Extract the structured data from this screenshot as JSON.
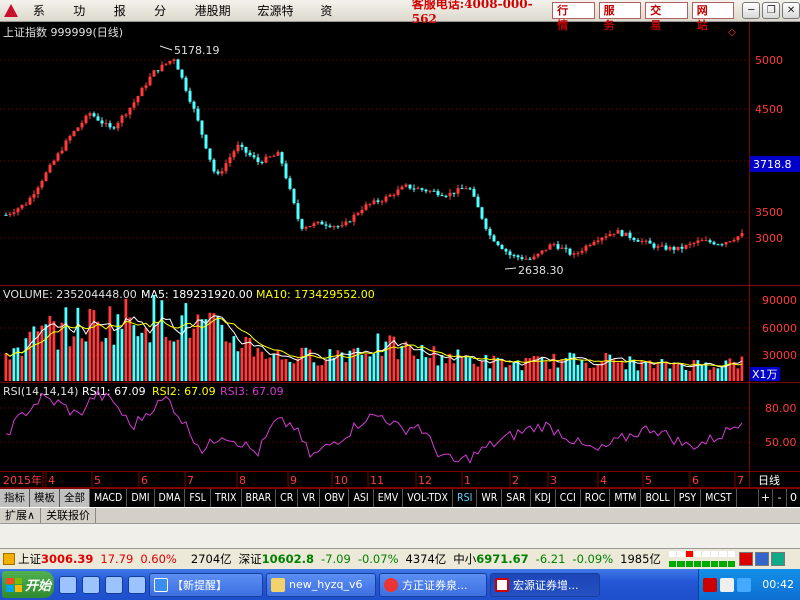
{
  "menubar": {
    "items": [
      "系统",
      "功能",
      "报价",
      "分析",
      "港股期货",
      "宏源特色",
      "资讯"
    ],
    "hotline": "客服电话:4008-000-562",
    "buttons": [
      "行 情",
      "服 务",
      "交 易",
      "网 站"
    ]
  },
  "main_panel": {
    "title": "上证指数 999999(日线)",
    "price_axis_ticks": [
      "5000",
      "4500",
      "4000",
      "3500",
      "3000"
    ],
    "current_price_tag": "3718.8",
    "high_label": "5178.19",
    "low_label": "2638.30"
  },
  "volume_panel": {
    "label": "VOLUME: 235204448.00",
    "ma5": "MA5: 189231920.00",
    "ma10": "MA10: 173429552.00",
    "axis_ticks": [
      "90000",
      "60000",
      "30000"
    ],
    "unit": "X1万"
  },
  "rsi_panel": {
    "label": "RSI(14,14,14)",
    "rsi1": "RSI1: 67.09",
    "rsi2": "RSI2: 67.09",
    "rsi3": "RSI3: 67.09",
    "axis_ticks": [
      "80.00",
      "50.00"
    ]
  },
  "time_axis": {
    "labels": [
      "2015年",
      "4",
      "5",
      "6",
      "7",
      "8",
      "9",
      "10",
      "11",
      "12",
      "1",
      "2",
      "3",
      "4",
      "5",
      "6",
      "7"
    ],
    "period": "日线"
  },
  "tabs": [
    "指标",
    "模板",
    "全部",
    "MACD",
    "DMI",
    "DMA",
    "FSL",
    "TRIX",
    "BRAR",
    "CR",
    "VR",
    "OBV",
    "ASI",
    "EMV",
    "VOL-TDX",
    "RSI",
    "WR",
    "SAR",
    "KDJ",
    "CCI",
    "ROC",
    "MTM",
    "BOLL",
    "PSY",
    "MCST"
  ],
  "tab_controls": [
    "+",
    "-",
    "0"
  ],
  "info_tabs": [
    "扩展∧",
    "关联报价"
  ],
  "statusbar": {
    "sh_name": "上证",
    "sh_value": "3006.39",
    "sh_change": "17.79",
    "sh_pct": "0.60%",
    "sh_amount": "2704亿",
    "sz_name": "深证",
    "sz_value": "10602.8",
    "sz_change": "-7.09",
    "sz_pct": "-0.07%",
    "sz_amount": "4374亿",
    "sm_name": "中小",
    "sm_value": "6971.67",
    "sm_change": "-6.21",
    "sm_pct": "-0.09%",
    "sm_amount": "1985亿"
  },
  "taskbar": {
    "start_label": "开始",
    "tasks": [
      "【新提醒】",
      "new_hyzq_v6",
      "方正证券泉...",
      "宏源证券增..."
    ],
    "clock": "00:42"
  },
  "colors": {
    "up": "#ff3c3c",
    "down": "#54ffff",
    "rsi": "#d23cd2",
    "ma5": "#ffffff",
    "ma10": "#ffff00",
    "grid": "#800000"
  },
  "chart_data": [
    {
      "type": "candlestick",
      "title": "上证指数 999999(日线)",
      "x_labels": [
        "2015年",
        "4",
        "5",
        "6",
        "7",
        "8",
        "9",
        "10",
        "11",
        "12",
        "1",
        "2",
        "3",
        "4",
        "5",
        "6",
        "7"
      ],
      "y_ticks": [
        3000,
        3500,
        4000,
        4500,
        5000
      ],
      "ylim": [
        2450,
        5300
      ],
      "annotations": [
        {
          "label": "5178.19",
          "value": 5178.19
        },
        {
          "label": "2638.30",
          "value": 2638.3
        },
        {
          "label": "3718.8",
          "value": 3718.8
        }
      ],
      "close_path": [
        {
          "m": "2015-03",
          "v": 3250
        },
        {
          "m": "2015-03",
          "v": 3400
        },
        {
          "m": "2015-04",
          "v": 3800
        },
        {
          "m": "2015-04",
          "v": 4200
        },
        {
          "m": "2015-05",
          "v": 4500
        },
        {
          "m": "2015-05",
          "v": 4300
        },
        {
          "m": "2015-05",
          "v": 4600
        },
        {
          "m": "2015-06",
          "v": 5000
        },
        {
          "m": "2015-06",
          "v": 5178
        },
        {
          "m": "2015-06",
          "v": 4500
        },
        {
          "m": "2015-07",
          "v": 3700
        },
        {
          "m": "2015-07",
          "v": 4100
        },
        {
          "m": "2015-07",
          "v": 3900
        },
        {
          "m": "2015-08",
          "v": 4000
        },
        {
          "m": "2015-08",
          "v": 3100
        },
        {
          "m": "2015-09",
          "v": 3150
        },
        {
          "m": "2015-09",
          "v": 3100
        },
        {
          "m": "2015-10",
          "v": 3350
        },
        {
          "m": "2015-10",
          "v": 3450
        },
        {
          "m": "2015-11",
          "v": 3600
        },
        {
          "m": "2015-11",
          "v": 3550
        },
        {
          "m": "2015-12",
          "v": 3500
        },
        {
          "m": "2015-12",
          "v": 3600
        },
        {
          "m": "2016-01",
          "v": 3000
        },
        {
          "m": "2016-01",
          "v": 2750
        },
        {
          "m": "2016-02",
          "v": 2700
        },
        {
          "m": "2016-02",
          "v": 2900
        },
        {
          "m": "2016-03",
          "v": 2750
        },
        {
          "m": "2016-03",
          "v": 2950
        },
        {
          "m": "2016-04",
          "v": 3050
        },
        {
          "m": "2016-04",
          "v": 2950
        },
        {
          "m": "2016-05",
          "v": 2850
        },
        {
          "m": "2016-05",
          "v": 2830
        },
        {
          "m": "2016-06",
          "v": 2930
        },
        {
          "m": "2016-06",
          "v": 2900
        },
        {
          "m": "2016-07",
          "v": 3006
        }
      ]
    },
    {
      "type": "bar",
      "title": "VOLUME",
      "unit": "X1万",
      "y_ticks": [
        30000,
        60000,
        90000
      ],
      "ylim": [
        0,
        100000
      ],
      "profile": [
        {
          "m": "2015-03",
          "v": 30000
        },
        {
          "m": "2015-04",
          "v": 55000
        },
        {
          "m": "2015-05",
          "v": 62000
        },
        {
          "m": "2015-06",
          "v": 70000
        },
        {
          "m": "2015-07",
          "v": 62000
        },
        {
          "m": "2015-08",
          "v": 45000
        },
        {
          "m": "2015-09",
          "v": 25000
        },
        {
          "m": "2015-10",
          "v": 28000
        },
        {
          "m": "2015-11",
          "v": 38000
        },
        {
          "m": "2015-12",
          "v": 30000
        },
        {
          "m": "2016-01",
          "v": 24000
        },
        {
          "m": "2016-02",
          "v": 18000
        },
        {
          "m": "2016-03",
          "v": 22000
        },
        {
          "m": "2016-04",
          "v": 23000
        },
        {
          "m": "2016-05",
          "v": 17000
        },
        {
          "m": "2016-06",
          "v": 18000
        },
        {
          "m": "2016-07",
          "v": 20000
        }
      ]
    },
    {
      "type": "line",
      "title": "RSI(14,14,14)",
      "y_ticks": [
        50,
        80
      ],
      "ylim": [
        25,
        95
      ],
      "series": [
        {
          "name": "RSI1",
          "values": [
            55,
            72,
            85,
            80,
            70,
            88,
            82,
            60,
            75,
            85,
            62,
            40,
            55,
            48,
            38,
            65,
            62,
            35,
            45,
            55,
            68,
            70,
            58,
            62,
            40,
            30,
            36,
            45,
            52,
            58,
            62,
            55,
            45,
            40,
            48,
            55,
            60,
            52,
            44,
            48,
            55,
            67
          ]
        }
      ]
    }
  ]
}
